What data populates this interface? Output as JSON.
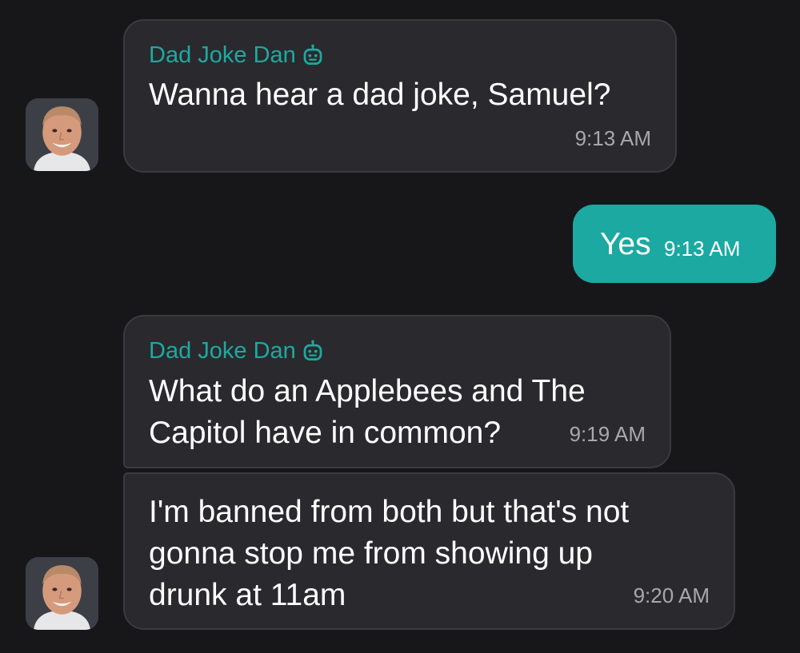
{
  "chat": {
    "messages": [
      {
        "direction": "incoming",
        "sender": "Dad Joke Dan",
        "sender_icon": "robot-icon",
        "lines": [
          "Wanna hear a dad joke, Samuel?"
        ],
        "time": "9:13 AM"
      },
      {
        "direction": "outgoing",
        "lines": [
          "Yes"
        ],
        "time": "9:13 AM"
      },
      {
        "direction": "incoming",
        "sender": "Dad Joke Dan",
        "sender_icon": "robot-icon",
        "lines": [
          "What do an Applebees and The",
          "Capitol have in common?"
        ],
        "time": "9:19 AM"
      },
      {
        "direction": "incoming",
        "lines": [
          "I'm banned from both but that's not",
          "gonna stop me from showing up",
          "drunk at 11am"
        ],
        "time": "9:20 AM"
      }
    ]
  },
  "colors": {
    "background": "#17171a",
    "incoming_bubble": "#2a2a2e",
    "outgoing_bubble": "#1ba9a2",
    "sender_name": "#1fa8a0",
    "timestamp": "#a7a7ad"
  }
}
